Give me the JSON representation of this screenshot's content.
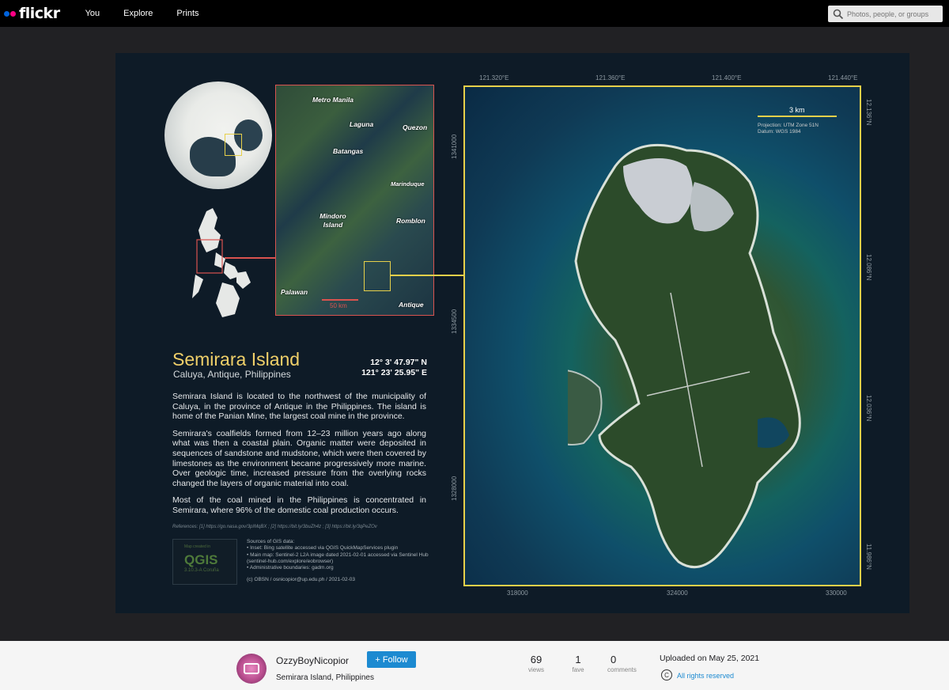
{
  "nav": {
    "logo": "flickr",
    "items": [
      "You",
      "Explore",
      "Prints"
    ],
    "search_placeholder": "Photos, people, or groups"
  },
  "map": {
    "title": "Semirara Island",
    "subtitle": "Caluya, Antique, Philippines",
    "lat": "12°  3' 47.97\" N",
    "lon": "121° 23' 25.95\" E",
    "paragraphs": [
      "Semirara Island is located to the northwest of the municipality of Caluya, in the province of Antique in the Philippines. The island is home of the Panian Mine, the largest coal mine in the province.",
      "Semirara's coalfields formed from 12–23 million years ago along what was then a coastal plain. Organic matter were deposited in sequences of sandstone and mudstone, which were then covered by limestones as the environment became progressively more marine. Over geologic time, increased pressure from the overlying rocks changed the layers of organic material into coal.",
      "Most of the coal mined in the Philippines is concentrated in Semirara, where 96% of the domestic coal production occurs."
    ],
    "references": "References: [1] https://go.nasa.gov/3pIMqBX ; [2] https://bit.ly/3buZh4z ; [3] https://bit.ly/3qPeZOv",
    "qgis_made": "Map created in",
    "qgis_name": "QGIS",
    "qgis_version": "3.10.3-A Coruña",
    "sources_title": "Sources of GIS data:",
    "sources": [
      "Inset: Bing satellite accessed via QGIS QuickMapServices plugin",
      "Main map: Sentinel-2 L2A image dated 2021-02-01 accessed via Sentinel Hub (sentinel-hub.com/explore/eobrowser)",
      "Administrative boundaries: gadm.org"
    ],
    "credit": "(c) OBSN  / osnicopior@up.edu.ph  /  2021-02-03",
    "inset_labels": [
      "Metro Manila",
      "Laguna",
      "Quezon",
      "Batangas",
      "Marinduque",
      "Mindoro Island",
      "Romblon",
      "Palawan",
      "Antique"
    ],
    "inset_scale": "50 km",
    "main_scale": "3 km",
    "projection": "Projection: UTM Zone 51N",
    "datum": "Datum: WGS 1984",
    "top_ticks": [
      "121.320°E",
      "121.360°E",
      "121.400°E",
      "121.440°E"
    ],
    "bottom_ticks": [
      "318000",
      "324000",
      "330000"
    ],
    "right_ticks": [
      "12.136°N",
      "12.086°N",
      "12.036°N",
      "11.986°N"
    ],
    "left_ticks": [
      "1341000",
      "1334500",
      "1328000"
    ]
  },
  "footer": {
    "owner": "OzzyBoyNicopior",
    "photo_title": "Semirara Island, Philippines",
    "follow": "+ Follow",
    "views": "69",
    "views_label": "views",
    "faves": "1",
    "faves_label": "fave",
    "comments": "0",
    "comments_label": "comments",
    "uploaded": "Uploaded on May 25, 2021",
    "rights": "All rights reserved"
  },
  "colors": {
    "accent": "#1c8ad1",
    "map_frame": "#e7d04a",
    "inset_frame": "#d9534f",
    "title": "#f0d069"
  }
}
